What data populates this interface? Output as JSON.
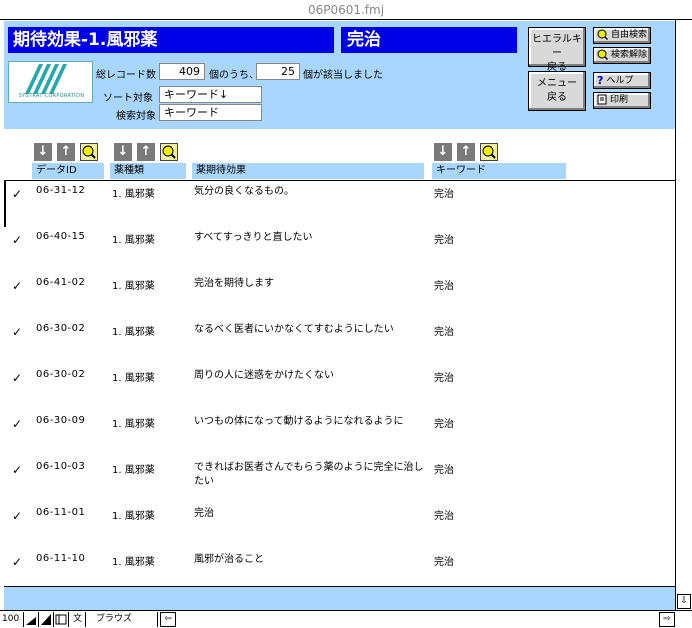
{
  "window": {
    "title": "06P0601.fmj"
  },
  "header": {
    "title": "期待効果-1.風邪薬",
    "keyword_title": "完治",
    "logo_text": "SYSTRAT CORPORATION",
    "total_label": "総レコード数",
    "total_count": "409",
    "of_label": "個のうち、",
    "found_count": "25",
    "found_label": "個が該当しました",
    "sort_label": "ソート対象",
    "sort_value": "キーワード↓",
    "search_label": "検索対象",
    "search_value": "キーワード"
  },
  "buttons": {
    "hierarchy_back": [
      "ヒエラルキー",
      "戻る"
    ],
    "menu_back": [
      "メニュー",
      "戻る"
    ],
    "free_search": "自由検索",
    "search_clear": "検索解除",
    "help": "ヘルプ",
    "print": "印刷"
  },
  "columns": {
    "data_id": "データID",
    "drug_type": "薬種類",
    "expected_effect": "薬期待効果",
    "keyword": "キーワード"
  },
  "sort_arrows": {
    "down": "↓",
    "up": "↑"
  },
  "rows": [
    {
      "check": "✓",
      "id": "06-31-12",
      "type": "1. 風邪薬",
      "effect": "気分の良くなるもの。",
      "keyword": "完治"
    },
    {
      "check": "✓",
      "id": "06-40-15",
      "type": "1. 風邪薬",
      "effect": "すべてすっきりと直したい",
      "keyword": "完治"
    },
    {
      "check": "✓",
      "id": "06-41-02",
      "type": "1. 風邪薬",
      "effect": "完治を期待します",
      "keyword": "完治"
    },
    {
      "check": "✓",
      "id": "06-30-02",
      "type": "1. 風邪薬",
      "effect": "なるべく医者にいかなくてすむようにしたい",
      "keyword": "完治"
    },
    {
      "check": "✓",
      "id": "06-30-02",
      "type": "1. 風邪薬",
      "effect": "周りの人に迷惑をかけたくない",
      "keyword": "完治"
    },
    {
      "check": "✓",
      "id": "06-30-09",
      "type": "1. 風邪薬",
      "effect": "いつもの体になって動けるようになれるように",
      "keyword": "完治"
    },
    {
      "check": "✓",
      "id": "06-10-03",
      "type": "1. 風邪薬",
      "effect": "できればお医者さんでもらう薬のように完全に治したい",
      "keyword": "完治"
    },
    {
      "check": "✓",
      "id": "06-11-01",
      "type": "1. 風邪薬",
      "effect": "完治",
      "keyword": "完治"
    },
    {
      "check": "✓",
      "id": "06-11-10",
      "type": "1. 風邪薬",
      "effect": "風邪が治ること",
      "keyword": "完治"
    }
  ],
  "statusbar": {
    "zoom": "100",
    "mode": "ブラウズ"
  }
}
